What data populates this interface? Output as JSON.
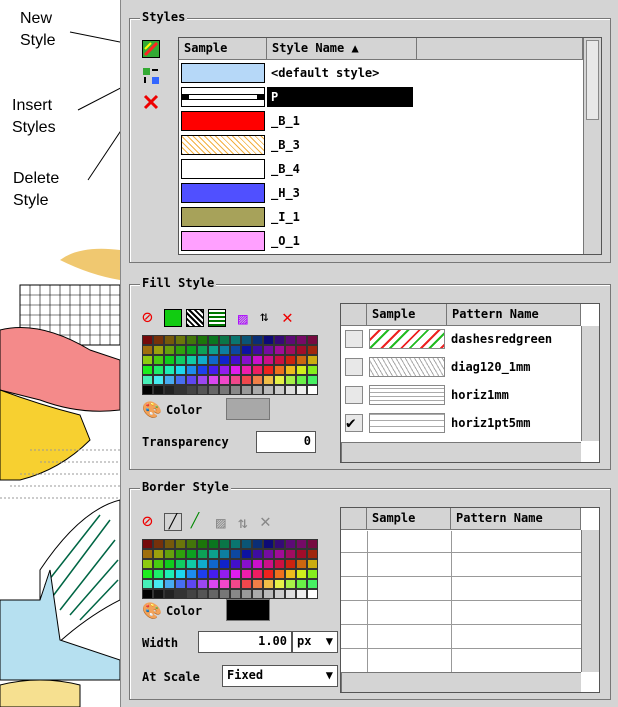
{
  "callouts": {
    "new_style": [
      "New",
      "Style"
    ],
    "insert_styles": [
      "Insert",
      "Styles"
    ],
    "delete_style": [
      "Delete",
      "Style"
    ]
  },
  "styles": {
    "title": "Styles",
    "col_sample": "Sample",
    "col_name": "Style Name ▲",
    "rows": [
      {
        "name": "<default style>",
        "color": "#b6d8f8"
      },
      {
        "name": "P",
        "color": "#ffffff"
      },
      {
        "name": "_B_1",
        "color": "#ff0000"
      },
      {
        "name": "_B_3",
        "color": "#ffd27a"
      },
      {
        "name": "_B_4",
        "color": "#ffffff"
      },
      {
        "name": "_H_3",
        "color": "#5050ff"
      },
      {
        "name": "_I_1",
        "color": "#a7a25a"
      },
      {
        "name": "_O_1",
        "color": "#ffa0ff"
      }
    ]
  },
  "fill": {
    "title": "Fill Style",
    "color_label": "Color",
    "transparency_label": "Transparency",
    "transparency_value": "0",
    "col_sample": "Sample",
    "col_pattern": "Pattern Name",
    "patterns": [
      {
        "name": "dashesredgreen",
        "checked": false
      },
      {
        "name": "diag120_1mm",
        "checked": false
      },
      {
        "name": "horiz1mm",
        "checked": false
      },
      {
        "name": "horiz1pt5mm",
        "checked": true
      }
    ]
  },
  "border": {
    "title": "Border Style",
    "color_label": "Color",
    "width_label": "Width",
    "width_value": "1.00",
    "width_unit": "px",
    "scale_label": "At Scale",
    "scale_value": "Fixed",
    "col_sample": "Sample",
    "col_pattern": "Pattern Name"
  }
}
